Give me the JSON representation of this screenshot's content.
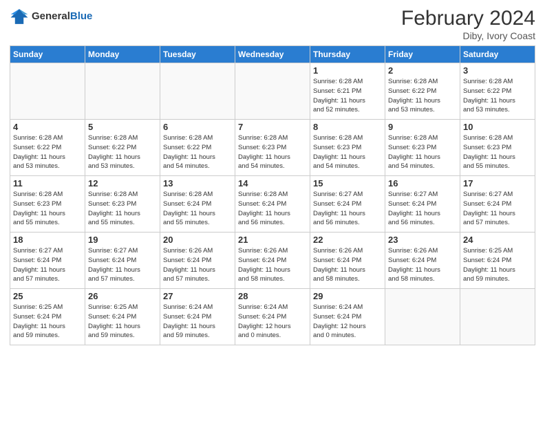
{
  "logo": {
    "line1": "General",
    "line2": "Blue"
  },
  "title": "February 2024",
  "location": "Diby, Ivory Coast",
  "weekdays": [
    "Sunday",
    "Monday",
    "Tuesday",
    "Wednesday",
    "Thursday",
    "Friday",
    "Saturday"
  ],
  "weeks": [
    [
      {
        "day": "",
        "info": ""
      },
      {
        "day": "",
        "info": ""
      },
      {
        "day": "",
        "info": ""
      },
      {
        "day": "",
        "info": ""
      },
      {
        "day": "1",
        "info": "Sunrise: 6:28 AM\nSunset: 6:21 PM\nDaylight: 11 hours\nand 52 minutes."
      },
      {
        "day": "2",
        "info": "Sunrise: 6:28 AM\nSunset: 6:22 PM\nDaylight: 11 hours\nand 53 minutes."
      },
      {
        "day": "3",
        "info": "Sunrise: 6:28 AM\nSunset: 6:22 PM\nDaylight: 11 hours\nand 53 minutes."
      }
    ],
    [
      {
        "day": "4",
        "info": "Sunrise: 6:28 AM\nSunset: 6:22 PM\nDaylight: 11 hours\nand 53 minutes."
      },
      {
        "day": "5",
        "info": "Sunrise: 6:28 AM\nSunset: 6:22 PM\nDaylight: 11 hours\nand 53 minutes."
      },
      {
        "day": "6",
        "info": "Sunrise: 6:28 AM\nSunset: 6:22 PM\nDaylight: 11 hours\nand 54 minutes."
      },
      {
        "day": "7",
        "info": "Sunrise: 6:28 AM\nSunset: 6:23 PM\nDaylight: 11 hours\nand 54 minutes."
      },
      {
        "day": "8",
        "info": "Sunrise: 6:28 AM\nSunset: 6:23 PM\nDaylight: 11 hours\nand 54 minutes."
      },
      {
        "day": "9",
        "info": "Sunrise: 6:28 AM\nSunset: 6:23 PM\nDaylight: 11 hours\nand 54 minutes."
      },
      {
        "day": "10",
        "info": "Sunrise: 6:28 AM\nSunset: 6:23 PM\nDaylight: 11 hours\nand 55 minutes."
      }
    ],
    [
      {
        "day": "11",
        "info": "Sunrise: 6:28 AM\nSunset: 6:23 PM\nDaylight: 11 hours\nand 55 minutes."
      },
      {
        "day": "12",
        "info": "Sunrise: 6:28 AM\nSunset: 6:23 PM\nDaylight: 11 hours\nand 55 minutes."
      },
      {
        "day": "13",
        "info": "Sunrise: 6:28 AM\nSunset: 6:24 PM\nDaylight: 11 hours\nand 55 minutes."
      },
      {
        "day": "14",
        "info": "Sunrise: 6:28 AM\nSunset: 6:24 PM\nDaylight: 11 hours\nand 56 minutes."
      },
      {
        "day": "15",
        "info": "Sunrise: 6:27 AM\nSunset: 6:24 PM\nDaylight: 11 hours\nand 56 minutes."
      },
      {
        "day": "16",
        "info": "Sunrise: 6:27 AM\nSunset: 6:24 PM\nDaylight: 11 hours\nand 56 minutes."
      },
      {
        "day": "17",
        "info": "Sunrise: 6:27 AM\nSunset: 6:24 PM\nDaylight: 11 hours\nand 57 minutes."
      }
    ],
    [
      {
        "day": "18",
        "info": "Sunrise: 6:27 AM\nSunset: 6:24 PM\nDaylight: 11 hours\nand 57 minutes."
      },
      {
        "day": "19",
        "info": "Sunrise: 6:27 AM\nSunset: 6:24 PM\nDaylight: 11 hours\nand 57 minutes."
      },
      {
        "day": "20",
        "info": "Sunrise: 6:26 AM\nSunset: 6:24 PM\nDaylight: 11 hours\nand 57 minutes."
      },
      {
        "day": "21",
        "info": "Sunrise: 6:26 AM\nSunset: 6:24 PM\nDaylight: 11 hours\nand 58 minutes."
      },
      {
        "day": "22",
        "info": "Sunrise: 6:26 AM\nSunset: 6:24 PM\nDaylight: 11 hours\nand 58 minutes."
      },
      {
        "day": "23",
        "info": "Sunrise: 6:26 AM\nSunset: 6:24 PM\nDaylight: 11 hours\nand 58 minutes."
      },
      {
        "day": "24",
        "info": "Sunrise: 6:25 AM\nSunset: 6:24 PM\nDaylight: 11 hours\nand 59 minutes."
      }
    ],
    [
      {
        "day": "25",
        "info": "Sunrise: 6:25 AM\nSunset: 6:24 PM\nDaylight: 11 hours\nand 59 minutes."
      },
      {
        "day": "26",
        "info": "Sunrise: 6:25 AM\nSunset: 6:24 PM\nDaylight: 11 hours\nand 59 minutes."
      },
      {
        "day": "27",
        "info": "Sunrise: 6:24 AM\nSunset: 6:24 PM\nDaylight: 11 hours\nand 59 minutes."
      },
      {
        "day": "28",
        "info": "Sunrise: 6:24 AM\nSunset: 6:24 PM\nDaylight: 12 hours\nand 0 minutes."
      },
      {
        "day": "29",
        "info": "Sunrise: 6:24 AM\nSunset: 6:24 PM\nDaylight: 12 hours\nand 0 minutes."
      },
      {
        "day": "",
        "info": ""
      },
      {
        "day": "",
        "info": ""
      }
    ]
  ]
}
